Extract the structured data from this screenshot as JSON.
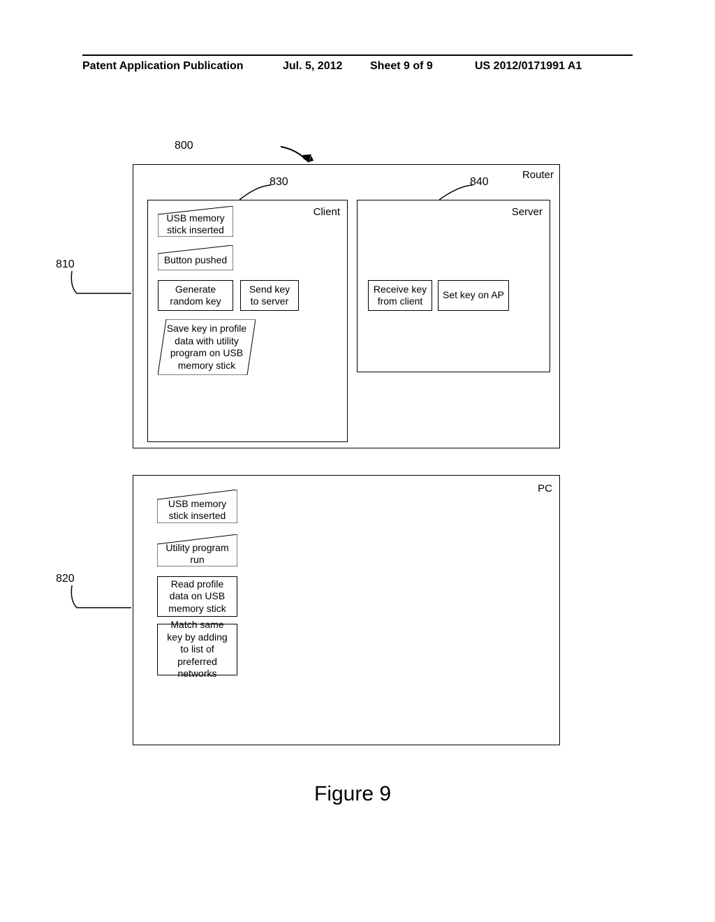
{
  "header": {
    "left": "Patent Application Publication",
    "date": "Jul. 5, 2012",
    "sheet": "Sheet 9 of 9",
    "pubnum": "US 2012/0171991 A1"
  },
  "refs": {
    "r800": "800",
    "r810": "810",
    "r820": "820",
    "r830": "830",
    "r840": "840"
  },
  "labels": {
    "router": "Router",
    "client": "Client",
    "server": "Server",
    "pc": "PC"
  },
  "router": {
    "client": {
      "usb_inserted": "USB memory stick inserted",
      "button_pushed": "Button pushed",
      "generate_key": "Generate random key",
      "send_key": "Send key to server",
      "save_key": "Save key in profile data with utility program on USB memory stick"
    },
    "server": {
      "receive_key": "Receive key from client",
      "set_key": "Set key on AP"
    }
  },
  "pc": {
    "usb_inserted": "USB memory stick inserted",
    "utility_run": "Utility program run",
    "read_profile": "Read profile data on USB memory stick",
    "match_key": "Match same key by adding to list of preferred networks"
  },
  "figure": "Figure 9"
}
